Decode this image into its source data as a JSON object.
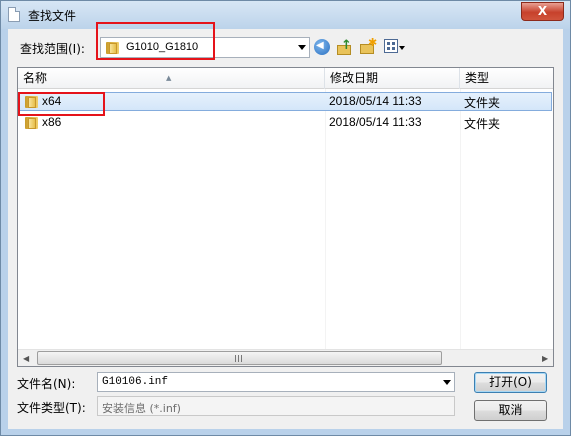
{
  "window": {
    "title": "查找文件",
    "close_label": "X"
  },
  "toolbar": {
    "lookin_label": "查找范围(I):",
    "lookin_value": "G1010_G1810"
  },
  "list": {
    "columns": [
      "名称",
      "修改日期",
      "类型"
    ],
    "rows": [
      {
        "name": "x64",
        "date": "2018/05/14 11:33",
        "type": "文件夹",
        "selected": true
      },
      {
        "name": "x86",
        "date": "2018/05/14 11:33",
        "type": "文件夹",
        "selected": false
      }
    ]
  },
  "form": {
    "filename_label": "文件名(N):",
    "filename_value": "G10106.inf",
    "filetype_label": "文件类型(T):",
    "filetype_value": "安装信息 (*.inf)",
    "open_label": "打开(O)",
    "cancel_label": "取消"
  },
  "icons": {
    "back": "back-icon",
    "up": "up-folder-icon",
    "new_folder": "new-folder-icon",
    "view": "view-menu-icon",
    "folder": "folder-icon"
  },
  "colors": {
    "highlight": "#e5131a",
    "selection": "#d4e6f9",
    "close": "#c7412c"
  }
}
